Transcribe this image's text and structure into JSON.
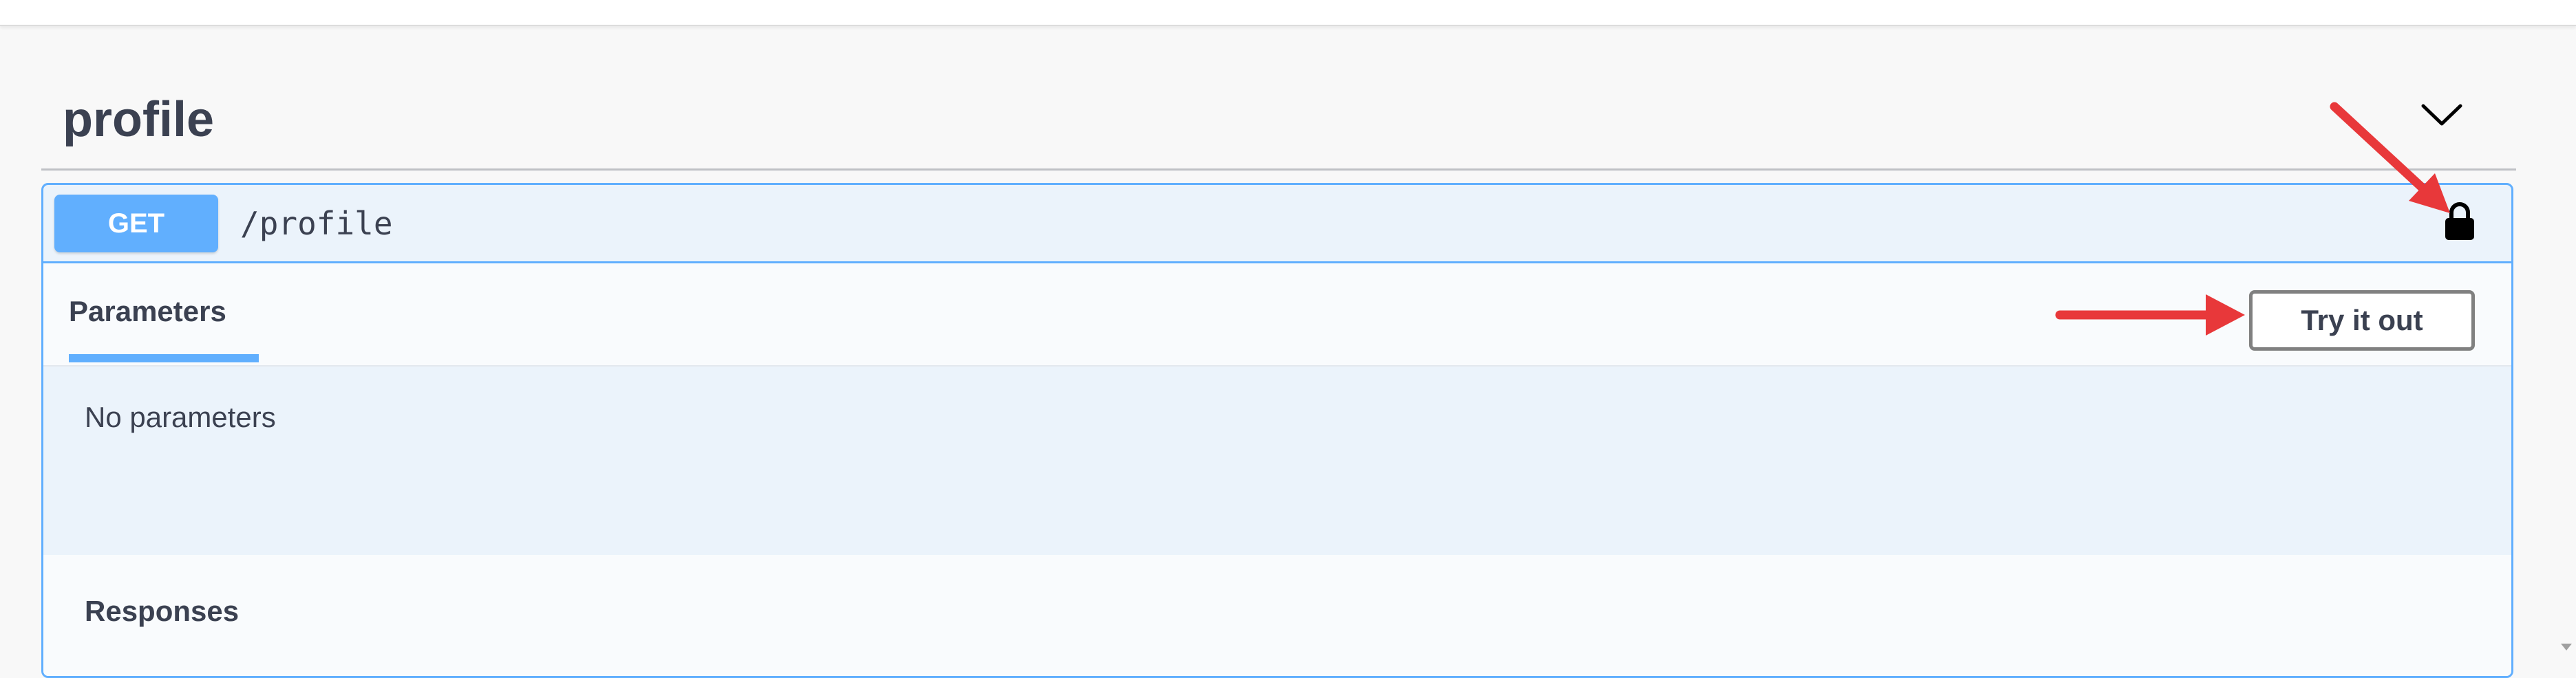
{
  "section": {
    "title": "profile"
  },
  "operation": {
    "method": "GET",
    "path": "/profile"
  },
  "tabs": {
    "parameters_label": "Parameters",
    "try_it_out_label": "Try it out"
  },
  "parameters": {
    "empty_text": "No parameters"
  },
  "responses": {
    "title": "Responses"
  },
  "icons": {
    "toggle": "chevron-down-icon",
    "lock": "lock-icon"
  },
  "colors": {
    "get_method": "#61affe",
    "get_background": "#ebf3fb",
    "annotation_arrow": "#e8383a",
    "text": "#3b4151"
  }
}
